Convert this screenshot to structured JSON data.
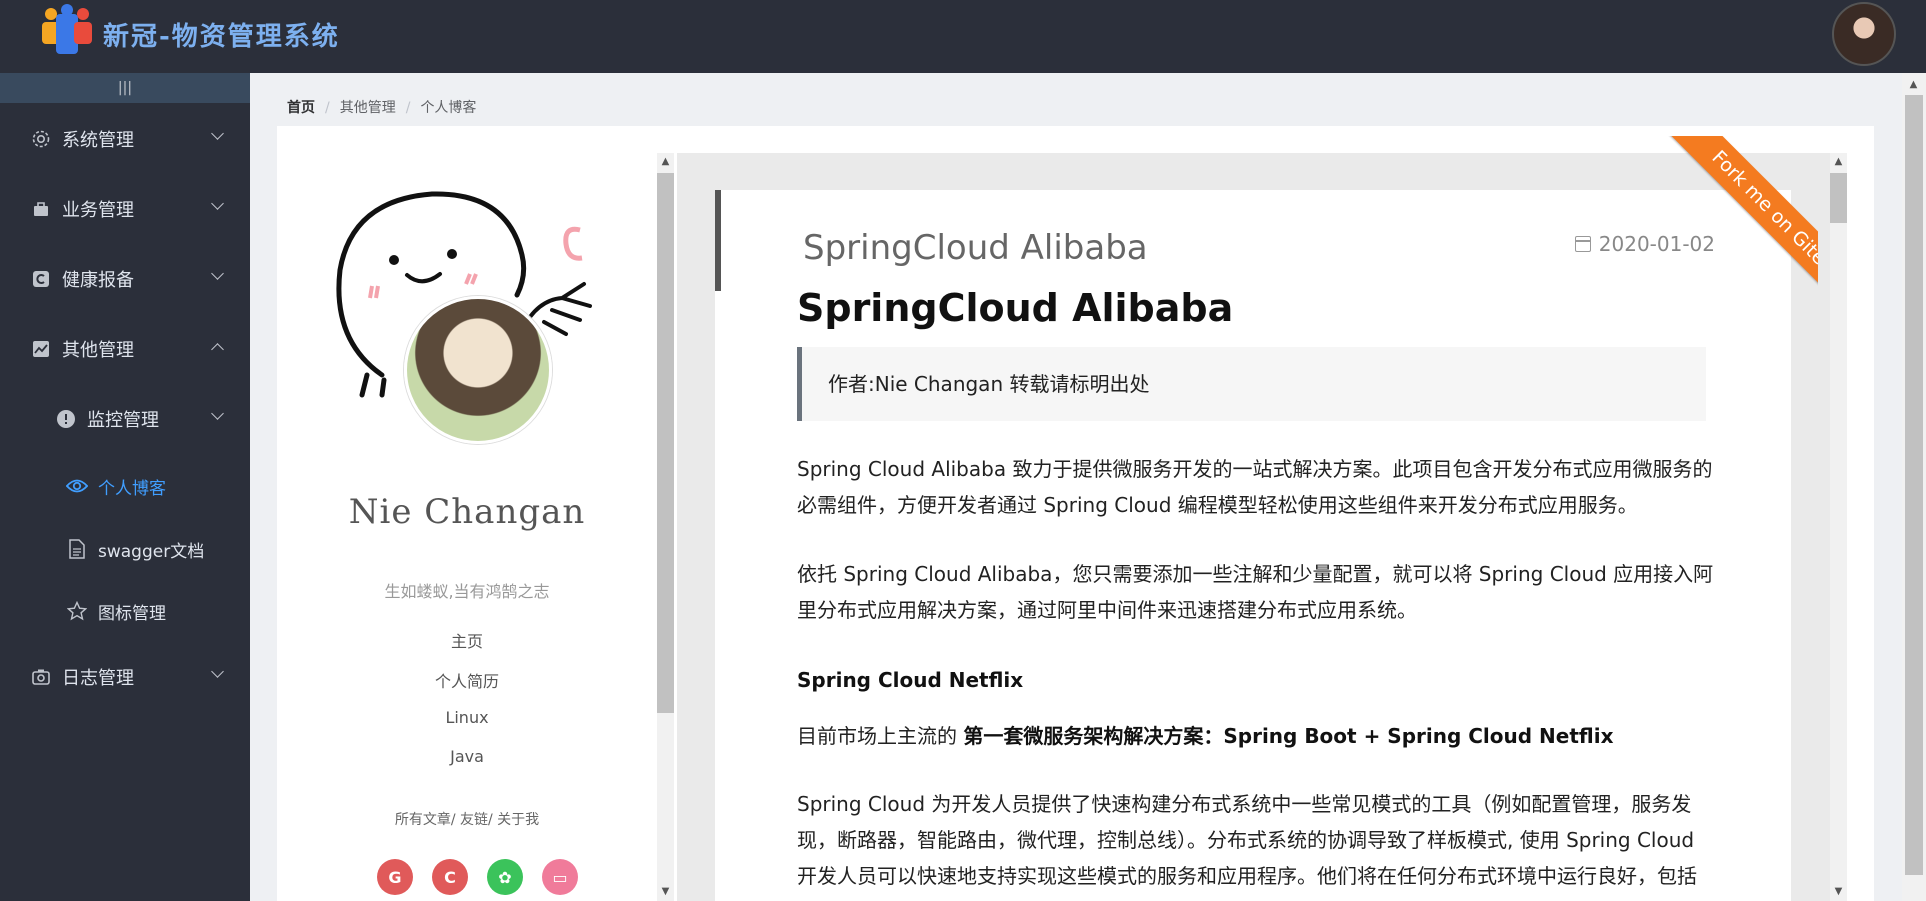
{
  "header": {
    "app_title": "新冠-物资管理系统"
  },
  "sidebar": {
    "collapse_glyph": "|||",
    "items": [
      {
        "label": "系统管理",
        "icon": "gear-icon",
        "expanded": false
      },
      {
        "label": "业务管理",
        "icon": "bag-icon",
        "expanded": false
      },
      {
        "label": "健康报备",
        "icon": "health-icon",
        "expanded": false
      },
      {
        "label": "其他管理",
        "icon": "chart-icon",
        "expanded": true
      },
      {
        "label": "监控管理",
        "icon": "alert-icon",
        "expanded": false
      },
      {
        "label": "个人博客",
        "icon": "eye-icon",
        "active": true
      },
      {
        "label": "swagger文档",
        "icon": "document-icon"
      },
      {
        "label": "图标管理",
        "icon": "star-icon"
      },
      {
        "label": "日志管理",
        "icon": "camera-icon",
        "expanded": false
      }
    ]
  },
  "breadcrumb": [
    "首页",
    "其他管理",
    "个人博客"
  ],
  "profile": {
    "name": "Nie Changan",
    "motto": "生如蝼蚁,当有鸿鹄之志",
    "links": [
      "主页",
      "个人简历",
      "Linux",
      "Java"
    ],
    "footer": "所有文章/ 友链/ 关于我",
    "socials": [
      {
        "name": "gitee",
        "glyph": "G",
        "color": "#e05a5a"
      },
      {
        "name": "csdn",
        "glyph": "C",
        "color": "#e05a5a"
      },
      {
        "name": "wechat",
        "glyph": "✿",
        "color": "#3bc35b"
      },
      {
        "name": "bilibili",
        "glyph": "▭",
        "color": "#f07b9a"
      }
    ]
  },
  "ribbon": "Fork me on Gitee",
  "article": {
    "title": "SpringCloud Alibaba",
    "date": "2020-01-02",
    "h1": "SpringCloud Alibaba",
    "quote": "作者:Nie Changan 转载请标明出处",
    "para1": "Spring Cloud Alibaba 致力于提供微服务开发的一站式解决方案。此项目包含开发分布式应用微服务的必需组件，方便开发者通过 Spring Cloud 编程模型轻松使用这些组件来开发分布式应用服务。",
    "para2": "依托 Spring Cloud Alibaba，您只需要添加一些注解和少量配置，就可以将 Spring Cloud 应用接入阿里分布式应用解决方案，通过阿里中间件来迅速搭建分布式应用系统。",
    "h3": "Spring Cloud Netflix",
    "para3_prefix": "目前市场上主流的 ",
    "para3_bold": "第一套微服务架构解决方案：Spring Boot + Spring Cloud Netflix",
    "para4": "Spring Cloud 为开发人员提供了快速构建分布式系统中一些常见模式的工具（例如配置管理，服务发现，断路器，智能路由，微代理，控制总线）。分布式系统的协调导致了样板模式, 使用 Spring Cloud 开发人员可以快速地支持实现这些模式的服务和应用程序。他们将在任何分布式环境中运行良好，包括"
  },
  "colors": {
    "sidebar_bg": "#2b2f3a",
    "active": "#409eff",
    "ribbon": "#f47b20"
  }
}
